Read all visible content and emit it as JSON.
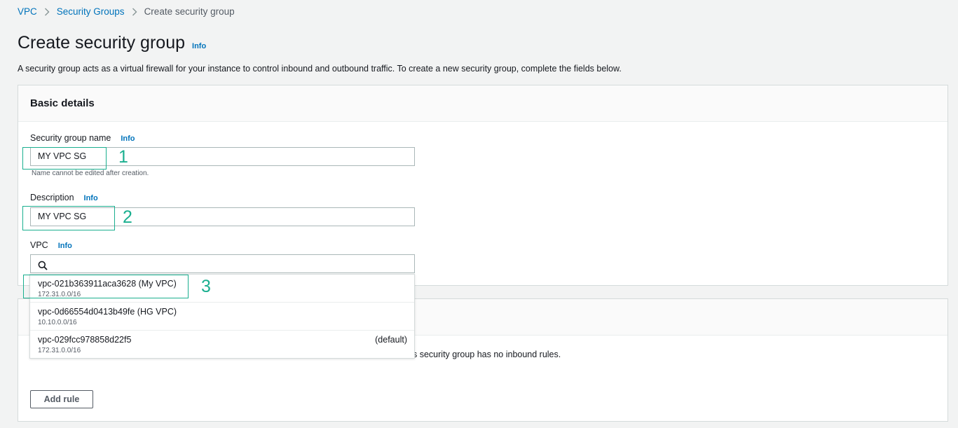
{
  "breadcrumb": {
    "items": [
      "VPC",
      "Security Groups"
    ],
    "current": "Create security group"
  },
  "page": {
    "title": "Create security group",
    "info": "Info",
    "subtitle": "A security group acts as a virtual firewall for your instance to control inbound and outbound traffic. To create a new security group, complete the fields below."
  },
  "basic_details": {
    "title": "Basic details",
    "name_field": {
      "label": "Security group name",
      "info": "Info",
      "value": "MY VPC SG",
      "hint": "Name cannot be edited after creation."
    },
    "description_field": {
      "label": "Description",
      "info": "Info",
      "value": "MY VPC SG"
    },
    "vpc_field": {
      "label": "VPC",
      "info": "Info",
      "value": ""
    }
  },
  "vpc_options": [
    {
      "name": "vpc-021b363911aca3628 (My VPC)",
      "cidr": "172.31.0.0/16",
      "tag": ""
    },
    {
      "name": "vpc-0d66554d0413b49fe (HG VPC)",
      "cidr": "10.10.0.0/16",
      "tag": ""
    },
    {
      "name": "vpc-029fcc978858d22f5",
      "cidr": "172.31.0.0/16",
      "tag": "(default)"
    }
  ],
  "inbound": {
    "empty_text": "s security group has no inbound rules.",
    "add_rule_label": "Add rule"
  },
  "annotations": [
    "1",
    "2",
    "3"
  ],
  "colors": {
    "link": "#0073bb",
    "annotation": "#1aaf8f",
    "background": "#f2f3f3"
  },
  "icons": {
    "breadcrumb_separator": "chevron-right-icon",
    "vpc_search": "search-icon"
  }
}
